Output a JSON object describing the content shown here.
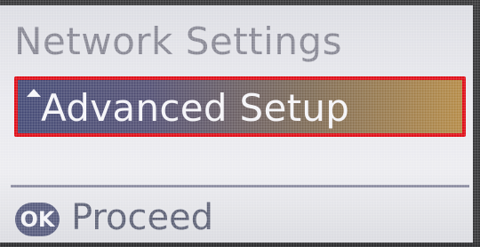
{
  "screen": {
    "title": "Network Settings",
    "selected_item": {
      "label": "Advanced Setup",
      "icon": "scroll-up-arrow-icon"
    },
    "footer": {
      "button_label": "OK",
      "action_label": "Proceed"
    }
  },
  "colors": {
    "highlight_start": "#3f4572",
    "highlight_end": "#b28741",
    "selection_outline": "#e0101a",
    "title_text": "#8a8a96",
    "ok_button": "#5a5f80"
  }
}
